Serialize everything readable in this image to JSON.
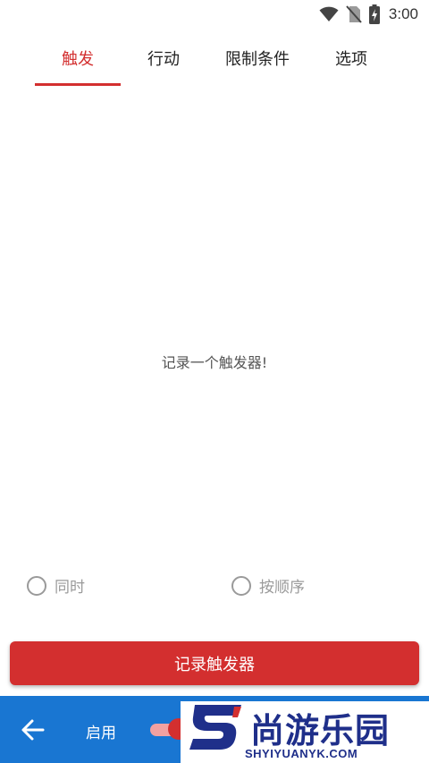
{
  "status_bar": {
    "time": "3:00",
    "icons": [
      "wifi-icon",
      "no-sim-icon",
      "battery-charging-icon"
    ]
  },
  "tabs": [
    {
      "label": "触发",
      "active": true
    },
    {
      "label": "行动",
      "active": false
    },
    {
      "label": "限制条件",
      "active": false
    },
    {
      "label": "选项",
      "active": false
    }
  ],
  "main": {
    "empty_message": "记录一个触发器!",
    "radio_options": [
      {
        "label": "同时",
        "selected": false
      },
      {
        "label": "按顺序",
        "selected": false
      }
    ],
    "record_button_label": "记录触发器"
  },
  "bottom_bar": {
    "enable_label": "启用",
    "enabled": true
  },
  "watermark": {
    "title": "尚游乐园",
    "subtitle": "SHYIYUANYK.COM"
  },
  "colors": {
    "accent": "#d32f2f",
    "bottom_bar": "#1976d2",
    "watermark": "#1f2f8a"
  }
}
